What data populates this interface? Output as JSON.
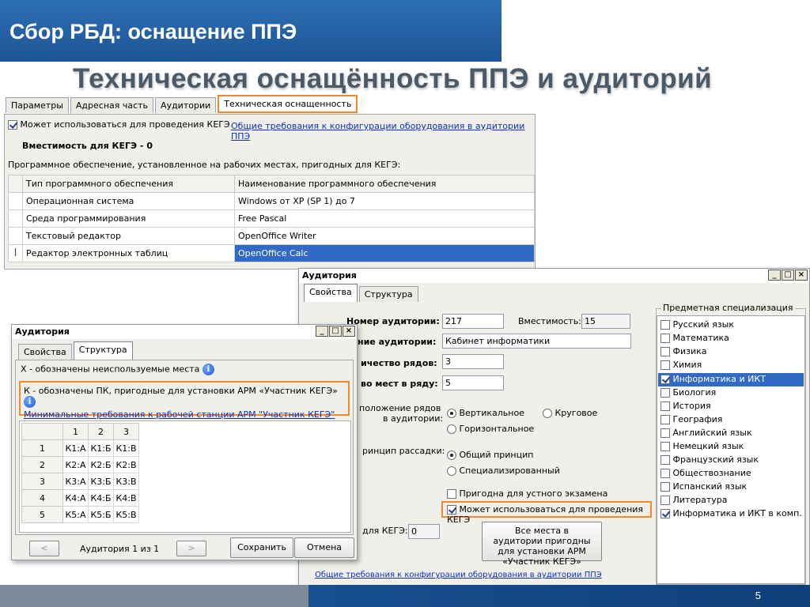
{
  "slide": {
    "header_title": "Сбор РБД: оснащение ППЭ",
    "subtitle": "Техническая оснащённость ППЭ и аудиторий",
    "page_number": "5"
  },
  "colors": {
    "highlight": "#f08a2a",
    "header_blue": "#1d5597",
    "selection": "#3169c6"
  },
  "main_window": {
    "tabs": [
      "Параметры",
      "Адресная часть",
      "Аудитории",
      "Техническая оснащенность"
    ],
    "active_tab": 3,
    "kege_checkbox_label": "Может использоваться для проведения КЕГЭ",
    "kege_checked": true,
    "requirements_link": "Общие требования к конфигурации оборудования в аудитории ППЭ",
    "capacity_label": "Вместимость для КЕГЭ - 0",
    "software_caption": "Программное обеспечение, установленное на рабочих местах, пригодных для КЕГЭ:",
    "table": {
      "headers": [
        "Тип программного обеспечения",
        "Наименование программного обеспечения"
      ],
      "rows": [
        [
          "Операционная система",
          "Windows от XP (SP 1) до 7"
        ],
        [
          "Среда программирования",
          "Free Pascal"
        ],
        [
          "Текстовый редактор",
          "OpenOffice Writer"
        ],
        [
          "Редактор электронных таблиц",
          "OpenOffice Calc"
        ]
      ],
      "cursor_icon": "text-cursor-icon"
    }
  },
  "struct_window": {
    "title": "Аудитория",
    "tabs": [
      "Свойства",
      "Структура"
    ],
    "active_tab": 1,
    "info1": "X - обозначены неиспользуемые места",
    "info2": "К - обозначены ПК, пригодные для установки АРМ «Участник КЕГЭ»",
    "min_req_link": "Минимальные требования к рабочей станции АРМ \"Участник КЕГЭ\"",
    "grid": {
      "col_headers": [
        "1",
        "2",
        "3"
      ],
      "row_headers": [
        "1",
        "2",
        "3",
        "4",
        "5"
      ],
      "cells": [
        [
          "К1:А",
          "К1:Б",
          "К1:В"
        ],
        [
          "К2:А",
          "К2:Б",
          "К2:В"
        ],
        [
          "К3:А",
          "К3:Б",
          "К3:В"
        ],
        [
          "К4:А",
          "К4:Б",
          "К4:В"
        ],
        [
          "К5:А",
          "К5:Б",
          "К5:В"
        ]
      ]
    },
    "prev_label": "<",
    "next_label": ">",
    "counter": "Аудитория 1 из 1",
    "save_label": "Сохранить",
    "cancel_label": "Отмена"
  },
  "props_window": {
    "title": "Аудитория",
    "tabs": [
      "Свойства",
      "Структура"
    ],
    "active_tab": 0,
    "number_label": "Номер аудитории:",
    "number_value": "217",
    "capacity_label": "Вместимость:",
    "capacity_value": "15",
    "name_label": "ние аудитории:",
    "name_value": "Кабинет информатики",
    "rows_label": "ичество рядов:",
    "rows_value": "3",
    "seats_label": "во мест в ряду:",
    "seats_value": "5",
    "layout_label_1": "положение рядов",
    "layout_label_2": "в аудитории:",
    "layout_options": [
      "Вертикальное",
      "Круговое",
      "Горизонтальное"
    ],
    "layout_selected": 0,
    "seating_label": "ринцип рассадки:",
    "seating_options": [
      "Общий принцип",
      "Специализированный"
    ],
    "seating_selected": 0,
    "oral_label": "Пригодна для устного экзамена",
    "oral_checked": false,
    "kege_label": "Может использоваться для проведения КЕГЭ",
    "kege_checked": true,
    "kege_cap_label": "для КЕГЭ:",
    "kege_cap_value": "0",
    "all_places_btn": "Все места в аудитории пригодны для установки АРМ «Участник КЕГЭ»",
    "requirements_link": "Общие требования к конфигурации оборудования в аудитории ППЭ",
    "subjects_title": "Предметная специализация",
    "subjects": [
      {
        "name": "Русский язык",
        "checked": false
      },
      {
        "name": "Математика",
        "checked": false
      },
      {
        "name": "Физика",
        "checked": false
      },
      {
        "name": "Химия",
        "checked": false
      },
      {
        "name": "Информатика и ИКТ",
        "checked": true
      },
      {
        "name": "Биология",
        "checked": false
      },
      {
        "name": "История",
        "checked": false
      },
      {
        "name": "География",
        "checked": false
      },
      {
        "name": "Английский язык",
        "checked": false
      },
      {
        "name": "Немецкий язык",
        "checked": false
      },
      {
        "name": "Французский язык",
        "checked": false
      },
      {
        "name": "Обществознание",
        "checked": false
      },
      {
        "name": "Испанский язык",
        "checked": false
      },
      {
        "name": "Литература",
        "checked": false
      },
      {
        "name": "Информатика и ИКТ в комп. фс",
        "checked": true
      }
    ],
    "selected_subject": 4
  }
}
